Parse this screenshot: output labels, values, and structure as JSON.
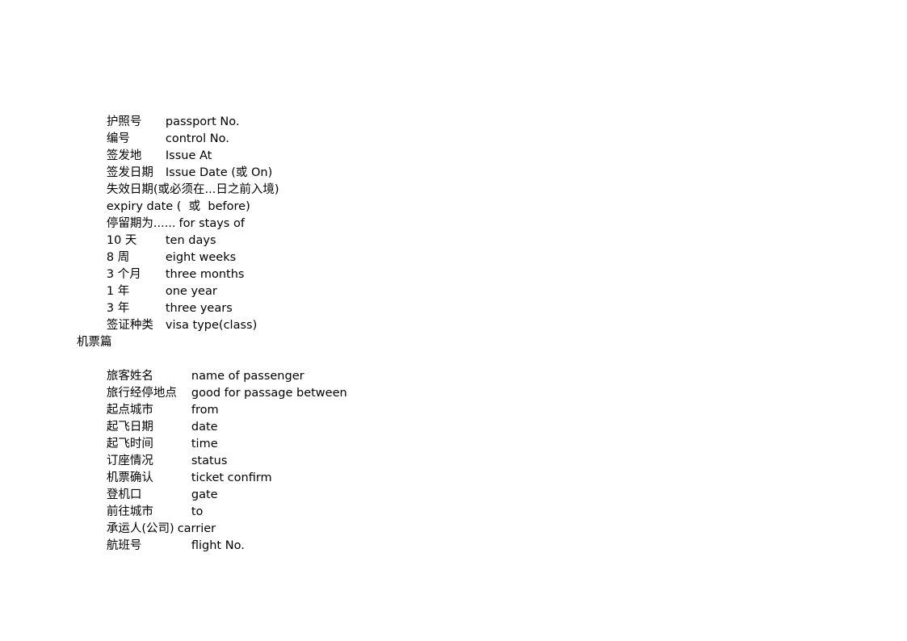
{
  "document": {
    "background_color": "#ffffff",
    "text_color": "#000000",
    "sections": [
      {
        "id": "visa-terms",
        "heading": "",
        "entries": [
          {
            "zh": "护照号",
            "en": "passport No.",
            "layout": "tab"
          },
          {
            "zh": "编号",
            "en": "control No.",
            "layout": "tab"
          },
          {
            "zh": "签发地",
            "en": "Issue At",
            "layout": "tab"
          },
          {
            "zh": "签发日期",
            "en": "Issue Date (或 On)",
            "layout": "tab"
          },
          {
            "zh": "失效日期(或必须在...日之前入境)",
            "en": "",
            "layout": "solo"
          },
          {
            "zh": "",
            "en": "expiry date (  或  before)",
            "layout": "solo-en"
          },
          {
            "zh": "停留期为......",
            "en": "for stays of",
            "layout": "inline"
          },
          {
            "zh": "10 天",
            "en": "ten days",
            "layout": "tab"
          },
          {
            "zh": "8 周",
            "en": "eight weeks",
            "layout": "tab"
          },
          {
            "zh": "3 个月",
            "en": "three months",
            "layout": "tab"
          },
          {
            "zh": "1 年",
            "en": "one year",
            "layout": "tab"
          },
          {
            "zh": "3 年",
            "en": "three years",
            "layout": "tab"
          },
          {
            "zh": "签证种类",
            "en": "visa type(class)",
            "layout": "tab"
          }
        ]
      },
      {
        "id": "ticket-terms",
        "heading": "机票篇",
        "entries": [
          {
            "zh": "旅客姓名",
            "en": "name of passenger",
            "layout": "tab"
          },
          {
            "zh": "旅行经停地点",
            "en": "good for passage between",
            "layout": "tab"
          },
          {
            "zh": "起点城市",
            "en": "from",
            "layout": "tab"
          },
          {
            "zh": "起飞日期",
            "en": "date",
            "layout": "tab"
          },
          {
            "zh": "起飞时间",
            "en": "time",
            "layout": "tab"
          },
          {
            "zh": "订座情况",
            "en": "status",
            "layout": "tab"
          },
          {
            "zh": "机票确认",
            "en": "ticket confirm",
            "layout": "tab"
          },
          {
            "zh": "登机口",
            "en": "gate",
            "layout": "tab"
          },
          {
            "zh": "前往城市",
            "en": "to",
            "layout": "tab"
          },
          {
            "zh": "承运人(公司)",
            "en": "carrier",
            "layout": "inline"
          },
          {
            "zh": "航班号",
            "en": "flight No.",
            "layout": "tab"
          }
        ]
      }
    ]
  }
}
